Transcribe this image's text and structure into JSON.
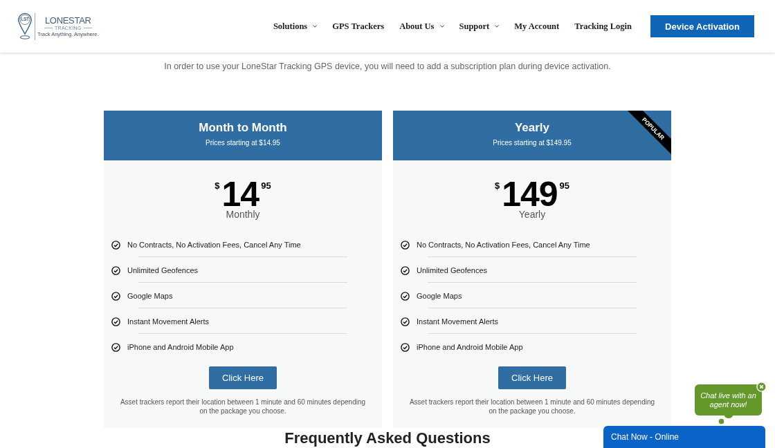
{
  "header": {
    "logo": {
      "monogram": "LST",
      "name": "LONESTAR",
      "subtitle": "TRACKING",
      "tagline": "Track Anything. Anywhere."
    },
    "nav": [
      {
        "label": "Solutions",
        "dropdown": true
      },
      {
        "label": "GPS Trackers",
        "dropdown": false
      },
      {
        "label": "About Us",
        "dropdown": true
      },
      {
        "label": "Support",
        "dropdown": true
      },
      {
        "label": "My Account",
        "dropdown": false
      },
      {
        "label": "Tracking Login",
        "dropdown": false
      }
    ],
    "cta_button": "Device Activation"
  },
  "intro": "In order to use your LoneStar Tracking GPS device, you will need to add a subscription plan during device activation.",
  "plans": [
    {
      "title": "Month to Month",
      "subtitle": "Prices starting at $14.95",
      "price": {
        "currency": "$",
        "whole": "14",
        "cents": "95"
      },
      "period": "Monthly",
      "features": [
        "No Contracts, No Activation Fees, Cancel Any Time",
        "Unlimited Geofences",
        "Google Maps",
        "Instant Movement Alerts",
        "iPhone and Android Mobile App"
      ],
      "button": "Click Here",
      "note": "Asset trackers report their location between 1 minute and 60 minutes depending on the package you choose."
    },
    {
      "title": "Yearly",
      "subtitle": "Prices starting at $149.95",
      "badge": "POPULAR",
      "price": {
        "currency": "$",
        "whole": "149",
        "cents": "95"
      },
      "period": "Yearly",
      "features": [
        "No Contracts, No Activation Fees, Cancel Any Time",
        "Unlimited Geofences",
        "Google Maps",
        "Instant Movement Alerts",
        "iPhone and Android Mobile App"
      ],
      "button": "Click Here",
      "note": "Asset trackers report their location between 1 minute and 60 minutes depending on the package you choose."
    }
  ],
  "faq_heading": "Frequently Asked Questions",
  "chat": {
    "prompt": "Chat live with an agent now!",
    "bar_label": "Chat Now - Online"
  }
}
